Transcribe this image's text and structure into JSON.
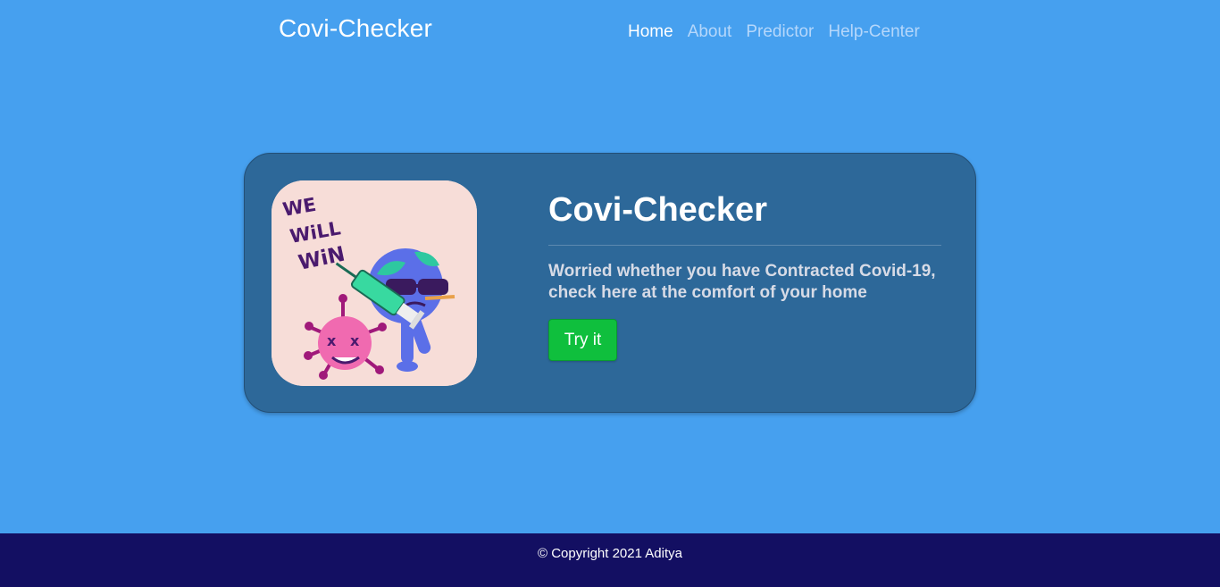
{
  "navbar": {
    "brand": "Covi-Checker",
    "links": [
      {
        "label": "Home",
        "active": true
      },
      {
        "label": "About",
        "active": false
      },
      {
        "label": "Predictor",
        "active": false
      },
      {
        "label": "Help-Center",
        "active": false
      }
    ]
  },
  "hero": {
    "image_text": [
      "WE",
      "WiLL",
      "WiN"
    ],
    "title": "Covi-Checker",
    "lead": "Worried whether you have Contracted Covid-19, check here at the comfort of your home",
    "button_label": "Try it"
  },
  "footer": {
    "copyright": "© Copyright 2021 Aditya"
  },
  "colors": {
    "page_bg": "#46a0ef",
    "card_bg": "#2d6899",
    "button_bg": "#0fbf3d",
    "footer_bg": "#130f62",
    "nav_active": "#ffffff",
    "nav_inactive": "#b5d7fb"
  },
  "icons": {
    "illustration": "earth-vaccinating-virus-illustration"
  }
}
